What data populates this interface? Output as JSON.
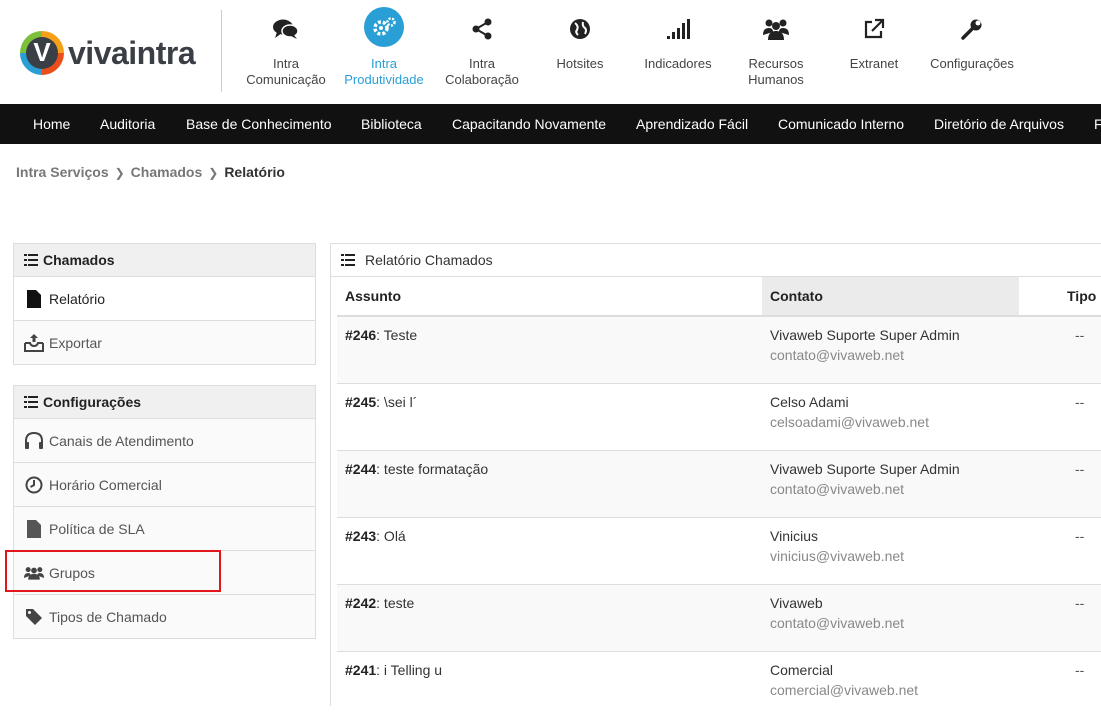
{
  "app": {
    "logo_text": "vivaintra",
    "logo_letter": "V"
  },
  "modules": [
    {
      "label": "Intra\nComunicação",
      "icon": "comments-icon"
    },
    {
      "label": "Intra\nProdutividade",
      "icon": "gears-icon",
      "active": true
    },
    {
      "label": "Intra\nColaboração",
      "icon": "share-icon"
    },
    {
      "label": "Hotsites",
      "icon": "globe-icon"
    },
    {
      "label": "Indicadores",
      "icon": "signal-icon"
    },
    {
      "label": "Recursos\nHumanos",
      "icon": "users-icon"
    },
    {
      "label": "Extranet",
      "icon": "external-link-icon"
    },
    {
      "label": "Configurações",
      "icon": "wrench-icon"
    }
  ],
  "navbar": [
    "Home",
    "Auditoria",
    "Base de Conhecimento",
    "Biblioteca",
    "Capacitando Novamente",
    "Aprendizado Fácil",
    "Comunicado Interno",
    "Diretório de Arquivos",
    "F"
  ],
  "breadcrumb": {
    "items": [
      "Intra Serviços",
      "Chamados"
    ],
    "current": "Relatório"
  },
  "sidebar": {
    "chamados": {
      "title": "Chamados",
      "items": [
        {
          "label": "Relatório",
          "icon": "file-icon"
        },
        {
          "label": "Exportar",
          "icon": "export-icon"
        }
      ]
    },
    "configuracoes": {
      "title": "Configurações",
      "items": [
        {
          "label": "Canais de Atendimento",
          "icon": "headset-icon"
        },
        {
          "label": "Horário Comercial",
          "icon": "clock-icon"
        },
        {
          "label": "Política de SLA",
          "icon": "document-icon"
        },
        {
          "label": "Grupos",
          "icon": "group-icon"
        },
        {
          "label": "Tipos de Chamado",
          "icon": "tag-icon"
        }
      ]
    }
  },
  "report": {
    "title": "Relatório Chamados",
    "columns": {
      "assunto": "Assunto",
      "contato": "Contato",
      "tipo": "Tipo"
    },
    "rows": [
      {
        "id": "#246",
        "subject": ": Teste",
        "name": "Vivaweb Suporte Super Admin",
        "email": "contato@vivaweb.net",
        "tipo": "--"
      },
      {
        "id": "#245",
        "subject": ": \\sei l´",
        "name": "Celso Adami",
        "email": "celsoadami@vivaweb.net",
        "tipo": "--"
      },
      {
        "id": "#244",
        "subject": ": teste formatação",
        "name": "Vivaweb Suporte Super Admin",
        "email": "contato@vivaweb.net",
        "tipo": "--"
      },
      {
        "id": "#243",
        "subject": ": Olá",
        "name": "Vinicius",
        "email": "vinicius@vivaweb.net",
        "tipo": "--"
      },
      {
        "id": "#242",
        "subject": ": teste",
        "name": "Vivaweb",
        "email": "contato@vivaweb.net",
        "tipo": "--"
      },
      {
        "id": "#241",
        "subject": ": i Telling u",
        "name": "Comercial",
        "email": "comercial@vivaweb.net",
        "tipo": "--"
      }
    ]
  },
  "colors": {
    "accent": "#2a9fd6",
    "navbar": "#111111",
    "highlight": "#e0161b"
  }
}
